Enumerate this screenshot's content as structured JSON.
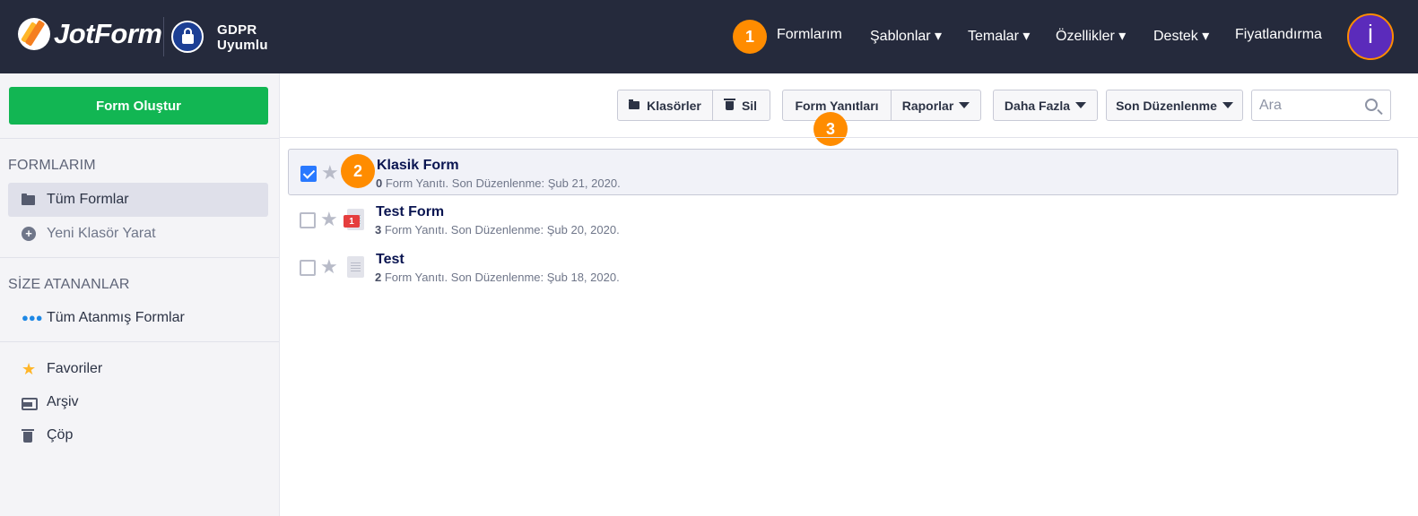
{
  "header": {
    "logo_text": "JotForm",
    "gdpr_line1": "GDPR",
    "gdpr_line2": "Uyumlu",
    "nav": [
      {
        "label": "Formlarım"
      },
      {
        "label": "Şablonlar ▾"
      },
      {
        "label": "Temalar ▾"
      },
      {
        "label": "Özellikler ▾"
      },
      {
        "label": "Destek ▾"
      },
      {
        "label": "Fiyatlandırma"
      }
    ],
    "avatar_initial": "İ"
  },
  "annotations": {
    "step1": "1",
    "step2": "2",
    "step3": "3"
  },
  "sidebar": {
    "create_button": "Form Oluştur",
    "section_forms": "FORMLARIM",
    "all_forms": "Tüm Formlar",
    "new_folder": "Yeni Klasör Yarat",
    "section_assigned": "SİZE ATANANLAR",
    "all_assigned": "Tüm Atanmış Formlar",
    "favorites": "Favoriler",
    "archive": "Arşiv",
    "trash": "Çöp"
  },
  "toolbar": {
    "folders": "Klasörler",
    "delete": "Sil",
    "responses": "Form Yanıtları",
    "reports": "Raporlar",
    "more": "Daha Fazla",
    "sort": "Son Düzenlenme",
    "search_placeholder": "Ara"
  },
  "forms": [
    {
      "title": "Klasik Form",
      "count": "0",
      "meta": " Form Yanıtı. Son Düzenlenme: Şub 21, 2020.",
      "selected": true
    },
    {
      "title": "Test Form",
      "count": "3",
      "meta": " Form Yanıtı. Son Düzenlenme: Şub 20, 2020.",
      "new_badge": "1"
    },
    {
      "title": "Test",
      "count": "2",
      "meta": " Form Yanıtı. Son Düzenlenme: Şub 18, 2020."
    }
  ],
  "colors": {
    "header_bg": "#252a3c",
    "create_green": "#12b653",
    "step_orange": "#ff8c00",
    "check_blue": "#2979ff",
    "avatar_purple": "#5b2bbb"
  }
}
